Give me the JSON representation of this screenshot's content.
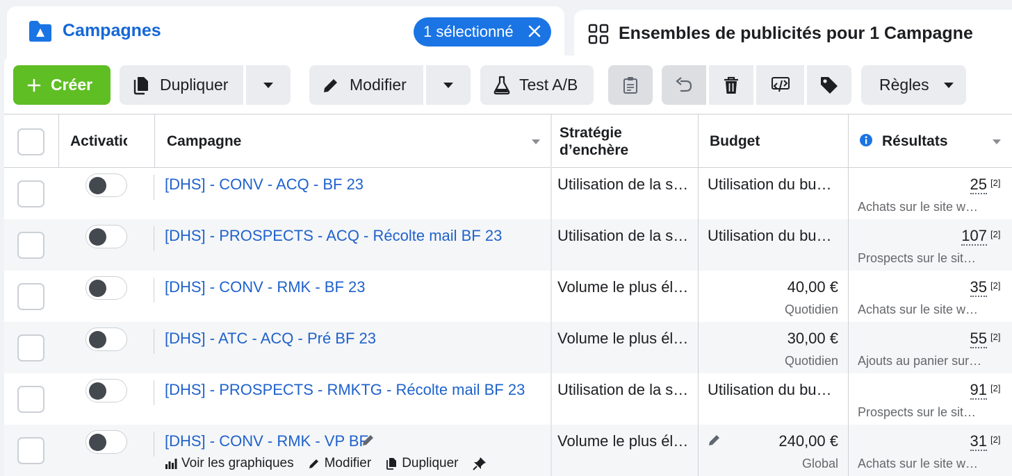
{
  "tabs": {
    "campaigns": {
      "label": "Campagnes"
    },
    "selection": {
      "label": "1 sélectionné"
    },
    "adsets": {
      "label": "Ensembles de publicités pour 1 Campagne"
    }
  },
  "toolbar": {
    "create": "Créer",
    "duplicate": "Dupliquer",
    "edit": "Modifier",
    "ab_test": "Test A/B",
    "rules": "Règles"
  },
  "columns": {
    "activation": "Activatio",
    "campaign": "Campagne",
    "bid_strategy_line1": "Stratégie",
    "bid_strategy_line2": "d’enchère",
    "budget": "Budget",
    "results": "Résultats"
  },
  "rows": [
    {
      "name": "[DHS] - CONV - ACQ - BF 23",
      "bid": "Utilisation de la s…",
      "budget": "Utilisation du bu…",
      "budget_sub": "",
      "result": "25",
      "result_note": "[2]",
      "result_type": "Achats sur le site w…"
    },
    {
      "name": "[DHS] - PROSPECTS - ACQ - Récolte mail BF 23",
      "bid": "Utilisation de la s…",
      "budget": "Utilisation du bu…",
      "budget_sub": "",
      "result": "107",
      "result_note": "[2]",
      "result_type": "Prospects sur le sit…"
    },
    {
      "name": "[DHS] - CONV - RMK - BF 23",
      "bid": "Volume le plus él…",
      "budget": "40,00 €",
      "budget_sub": "Quotidien",
      "result": "35",
      "result_note": "[2]",
      "result_type": "Achats sur le site w…"
    },
    {
      "name": "[DHS] - ATC - ACQ - Pré BF 23",
      "bid": "Volume le plus él…",
      "budget": "30,00 €",
      "budget_sub": "Quotidien",
      "result": "55",
      "result_note": "[2]",
      "result_type": "Ajouts au panier sur…"
    },
    {
      "name": "[DHS] - PROSPECTS - RMKTG - Récolte mail BF 23",
      "bid": "Utilisation de la s…",
      "budget": "Utilisation du bu…",
      "budget_sub": "",
      "result": "91",
      "result_note": "[2]",
      "result_type": "Prospects sur le sit…"
    },
    {
      "name": "[DHS] - CONV - RMK - VP BF",
      "bid": "Volume le plus él…",
      "budget": "240,00 €",
      "budget_sub": "Global",
      "result": "31",
      "result_note": "[2]",
      "result_type": "Achats sur le site w…"
    }
  ],
  "row_actions": {
    "charts": "Voir les graphiques",
    "edit": "Modifier",
    "duplicate": "Dupliquer"
  },
  "colors": {
    "accent": "#1b74e4",
    "link": "#1f62cc",
    "create": "#5fbe24"
  }
}
